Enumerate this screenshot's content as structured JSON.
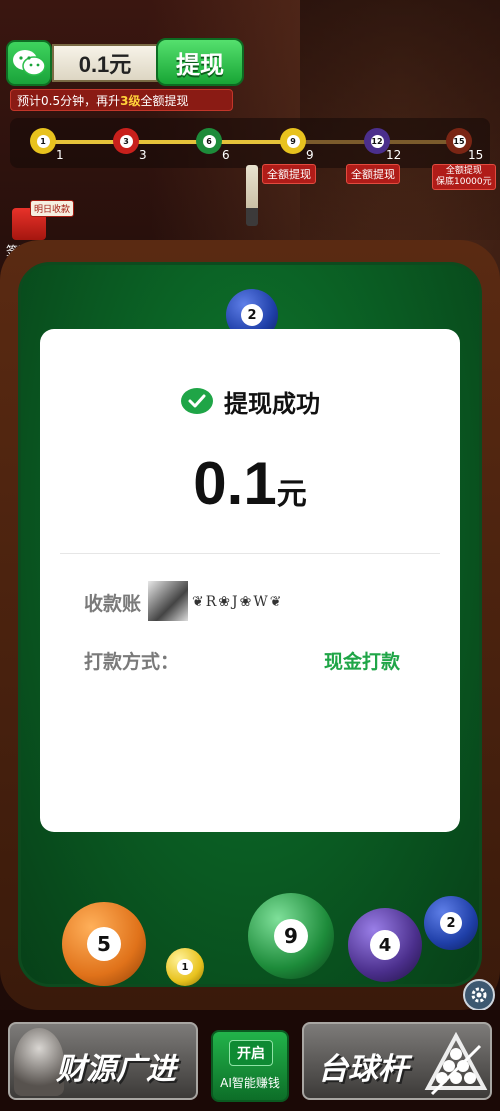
{
  "topbar": {
    "balance": "0.1元",
    "withdraw_label": "提现",
    "tip_prefix": "预计0.5分钟，再升",
    "tip_highlight": "3级",
    "tip_suffix": "全额提现"
  },
  "progress": {
    "milestones": [
      {
        "ball": "1",
        "label": "1",
        "color": "#e8c21e"
      },
      {
        "ball": "3",
        "label": "3",
        "color": "#c8201c"
      },
      {
        "ball": "6",
        "label": "6",
        "color": "#1d8b3a"
      },
      {
        "ball": "9",
        "label": "9",
        "color": "#e8c21e",
        "tag": "全额提现"
      },
      {
        "ball": "12",
        "label": "12",
        "color": "#4b2f8c",
        "tag": "全额提现"
      },
      {
        "ball": "15",
        "label": "15",
        "color": "#7a2514",
        "tag_line1": "全额提现",
        "tag_line2": "保底10000元"
      }
    ]
  },
  "signin": {
    "tag": "明日收款",
    "label": "签到提现"
  },
  "modal": {
    "title": "提现成功",
    "amount": "0.1",
    "unit": "元",
    "payee_label": "收款账",
    "payee_name": "❦R❀J❀W❦",
    "method_label": "打款方式：",
    "method_value": "现金打款"
  },
  "table_balls": [
    {
      "number": "2",
      "color": "#1f3fa8"
    },
    {
      "number": "5",
      "color": "#e0721a"
    },
    {
      "number": "1",
      "color": "#e8c21e"
    },
    {
      "number": "9",
      "color": "#1d8b3a"
    },
    {
      "number": "4",
      "color": "#4b2f8c"
    },
    {
      "number": "2",
      "color": "#1f3fa8"
    }
  ],
  "bottom": {
    "wealth_label": "财源广进",
    "ai_open": "开启",
    "ai_label": "AI智能赚钱",
    "cue_label": "台球杆"
  },
  "icons": {
    "wechat": "wechat-icon",
    "check": "check-circle-icon",
    "settings": "gear-icon",
    "rack": "ball-rack-icon"
  },
  "colors": {
    "accent_green": "#1fa547",
    "felt": "#0a5a22",
    "tag_red": "#b01c18"
  }
}
